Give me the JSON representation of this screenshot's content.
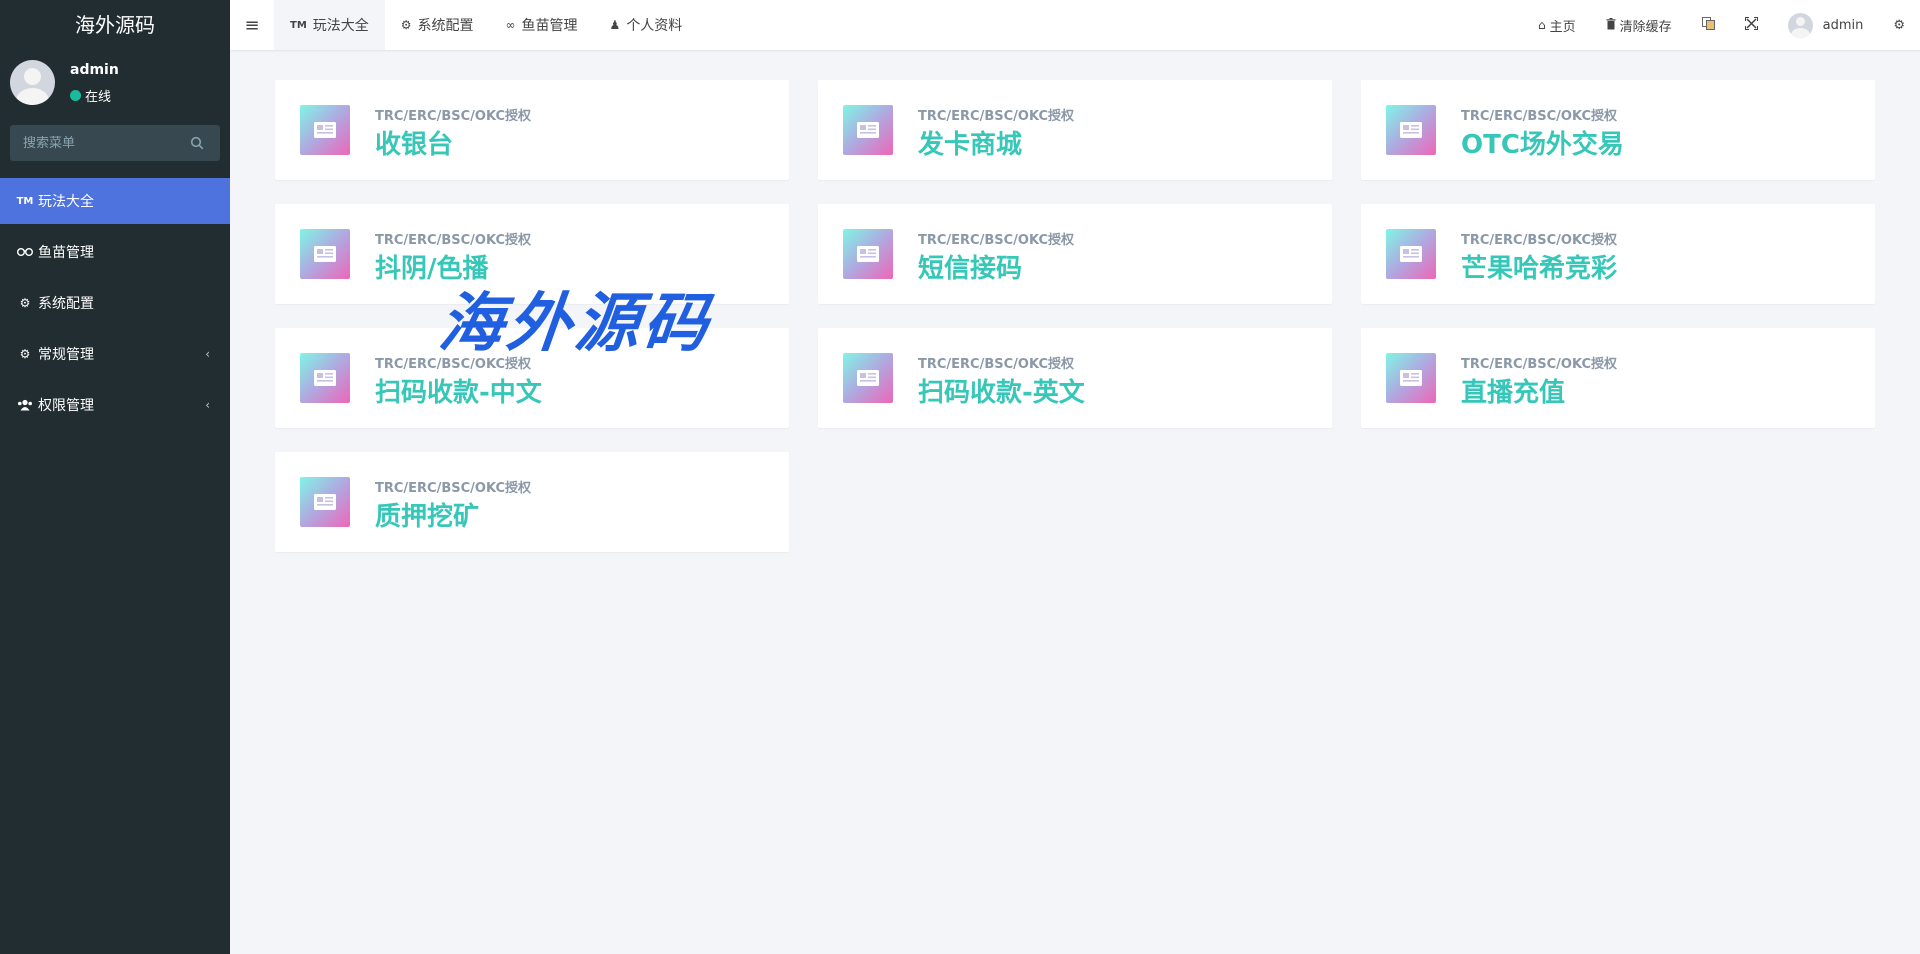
{
  "sidebar": {
    "brand": "海外源码",
    "user": {
      "name": "admin",
      "status": "在线"
    },
    "search": {
      "placeholder": "搜索菜单"
    },
    "items": [
      {
        "label": "玩法大全",
        "icon": "tm-icon",
        "active": true
      },
      {
        "label": "鱼苗管理",
        "icon": "binoculars-icon"
      },
      {
        "label": "系统配置",
        "icon": "gear-icon"
      },
      {
        "label": "常规管理",
        "icon": "cogs-icon",
        "chevron": "‹"
      },
      {
        "label": "权限管理",
        "icon": "users-icon",
        "chevron": "‹"
      }
    ]
  },
  "header": {
    "tabs": [
      {
        "label": "玩法大全",
        "icon": "TM"
      },
      {
        "label": "系统配置",
        "icon": "⚙"
      },
      {
        "label": "鱼苗管理",
        "icon": "∞"
      },
      {
        "label": "个人资料",
        "icon": "♟"
      }
    ],
    "right": {
      "home": "主页",
      "clear_cache": "清除缓存",
      "username": "admin"
    }
  },
  "cards": [
    {
      "subtitle": "TRC/ERC/BSC/OKC授权",
      "title": "收银台"
    },
    {
      "subtitle": "TRC/ERC/BSC/OKC授权",
      "title": "发卡商城"
    },
    {
      "subtitle": "TRC/ERC/BSC/OKC授权",
      "title": "OTC场外交易"
    },
    {
      "subtitle": "TRC/ERC/BSC/OKC授权",
      "title": "抖阴/色播"
    },
    {
      "subtitle": "TRC/ERC/BSC/OKC授权",
      "title": "短信接码"
    },
    {
      "subtitle": "TRC/ERC/BSC/OKC授权",
      "title": "芒果哈希竞彩"
    },
    {
      "subtitle": "TRC/ERC/BSC/OKC授权",
      "title": "扫码收款-中文"
    },
    {
      "subtitle": "TRC/ERC/BSC/OKC授权",
      "title": "扫码收款-英文"
    },
    {
      "subtitle": "TRC/ERC/BSC/OKC授权",
      "title": "直播充值"
    },
    {
      "subtitle": "TRC/ERC/BSC/OKC授权",
      "title": "质押挖矿"
    }
  ],
  "watermark": "海外源码",
  "colors": {
    "sidebar_bg": "#222d32",
    "active_menu": "#4e73df",
    "card_title": "#37c7b8",
    "status_online": "#18bc9c"
  }
}
